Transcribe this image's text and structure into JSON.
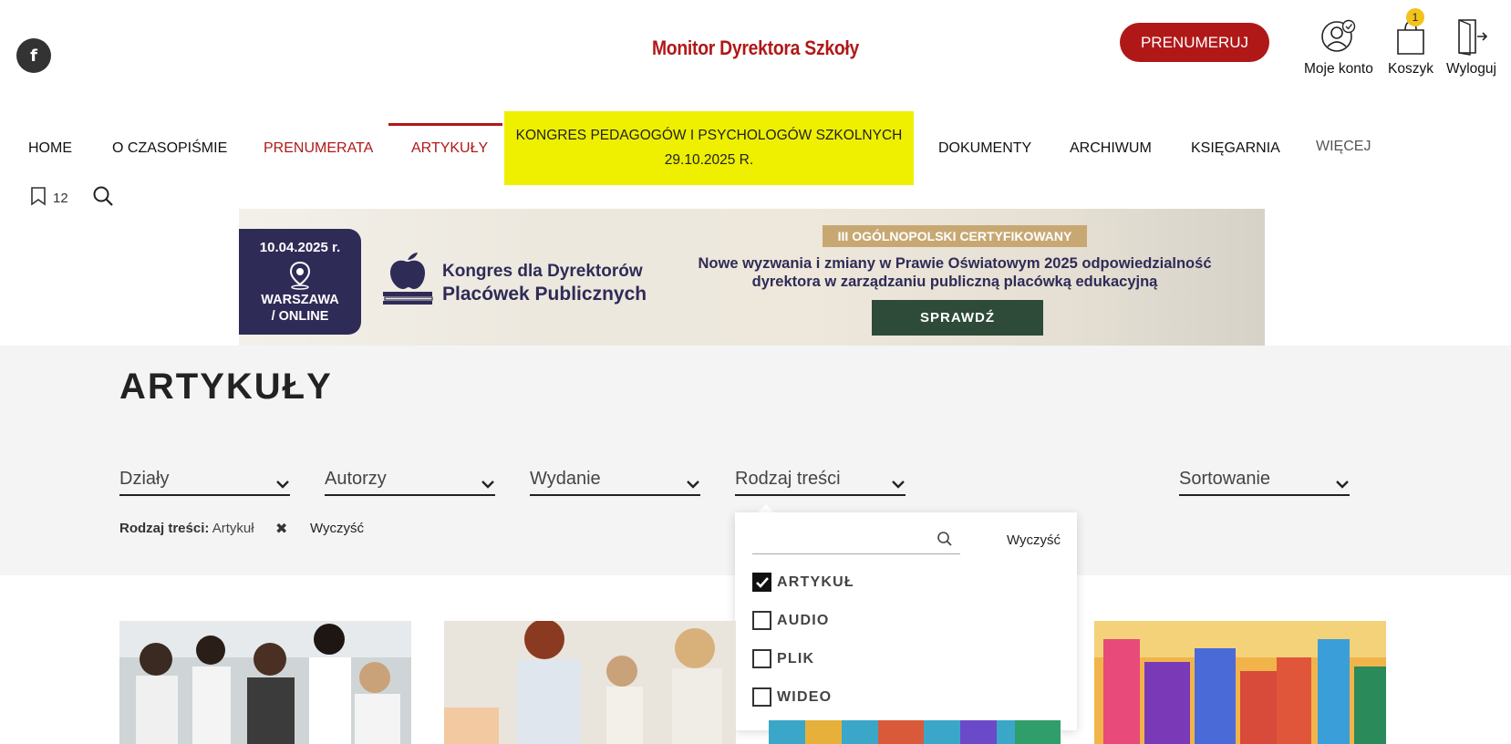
{
  "header": {
    "logo": "Monitor Dyrektora Szkoły",
    "subscribe": "PRENUMERUJ",
    "account": "Moje konto",
    "cart": "Koszyk",
    "cart_count": "1",
    "logout": "Wyloguj",
    "facebook": "f"
  },
  "nav": {
    "items": [
      "HOME",
      "O CZASOPIŚMIE",
      "PRENUMERATA",
      "ARTYKUŁY"
    ],
    "highlight_line1": "KONGRES PEDAGOGÓW I PSYCHOLOGÓW SZKOLNYCH",
    "highlight_line2": "29.10.2025 R.",
    "items_right": [
      "DOKUMENTY",
      "ARCHIWUM",
      "KSIĘGARNIA",
      "WIĘCEJ"
    ],
    "bookmarks_count": "12"
  },
  "banner": {
    "date": "10.04.2025 r.",
    "location_line1": "WARSZAWA",
    "location_line2": "/ ONLINE",
    "title_line1": "Kongres dla Dyrektorów",
    "title_line2": "Placówek Publicznych",
    "cert": "III OGÓLNOPOLSKI CERTYFIKOWANY",
    "desc_line1": "Nowe wyzwania i zmiany w Prawie Oświatowym 2025 odpowiedzialność",
    "desc_line2": "dyrektora w zarządzaniu publiczną placówką edukacyjną",
    "button": "SPRAWDŹ"
  },
  "page": {
    "title": "ARTYKUŁY"
  },
  "filters": {
    "dzialy": "Działy",
    "autorzy": "Autorzy",
    "wydanie": "Wydanie",
    "rodzaj": "Rodzaj treści",
    "sortowanie": "Sortowanie",
    "active_label": "Rodzaj treści:",
    "active_value": "Artykuł",
    "clear": "Wyczyść"
  },
  "popup": {
    "search_placeholder": "",
    "clear": "Wyczyść",
    "options": [
      {
        "label": "ARTYKUŁ",
        "checked": true
      },
      {
        "label": "AUDIO",
        "checked": false
      },
      {
        "label": "PLIK",
        "checked": false
      },
      {
        "label": "WIDEO",
        "checked": false
      }
    ]
  },
  "colors": {
    "brand": "#b01818",
    "highlight": "#eef000",
    "banner_navy": "#2f2b57",
    "banner_button": "#2e4a38"
  }
}
